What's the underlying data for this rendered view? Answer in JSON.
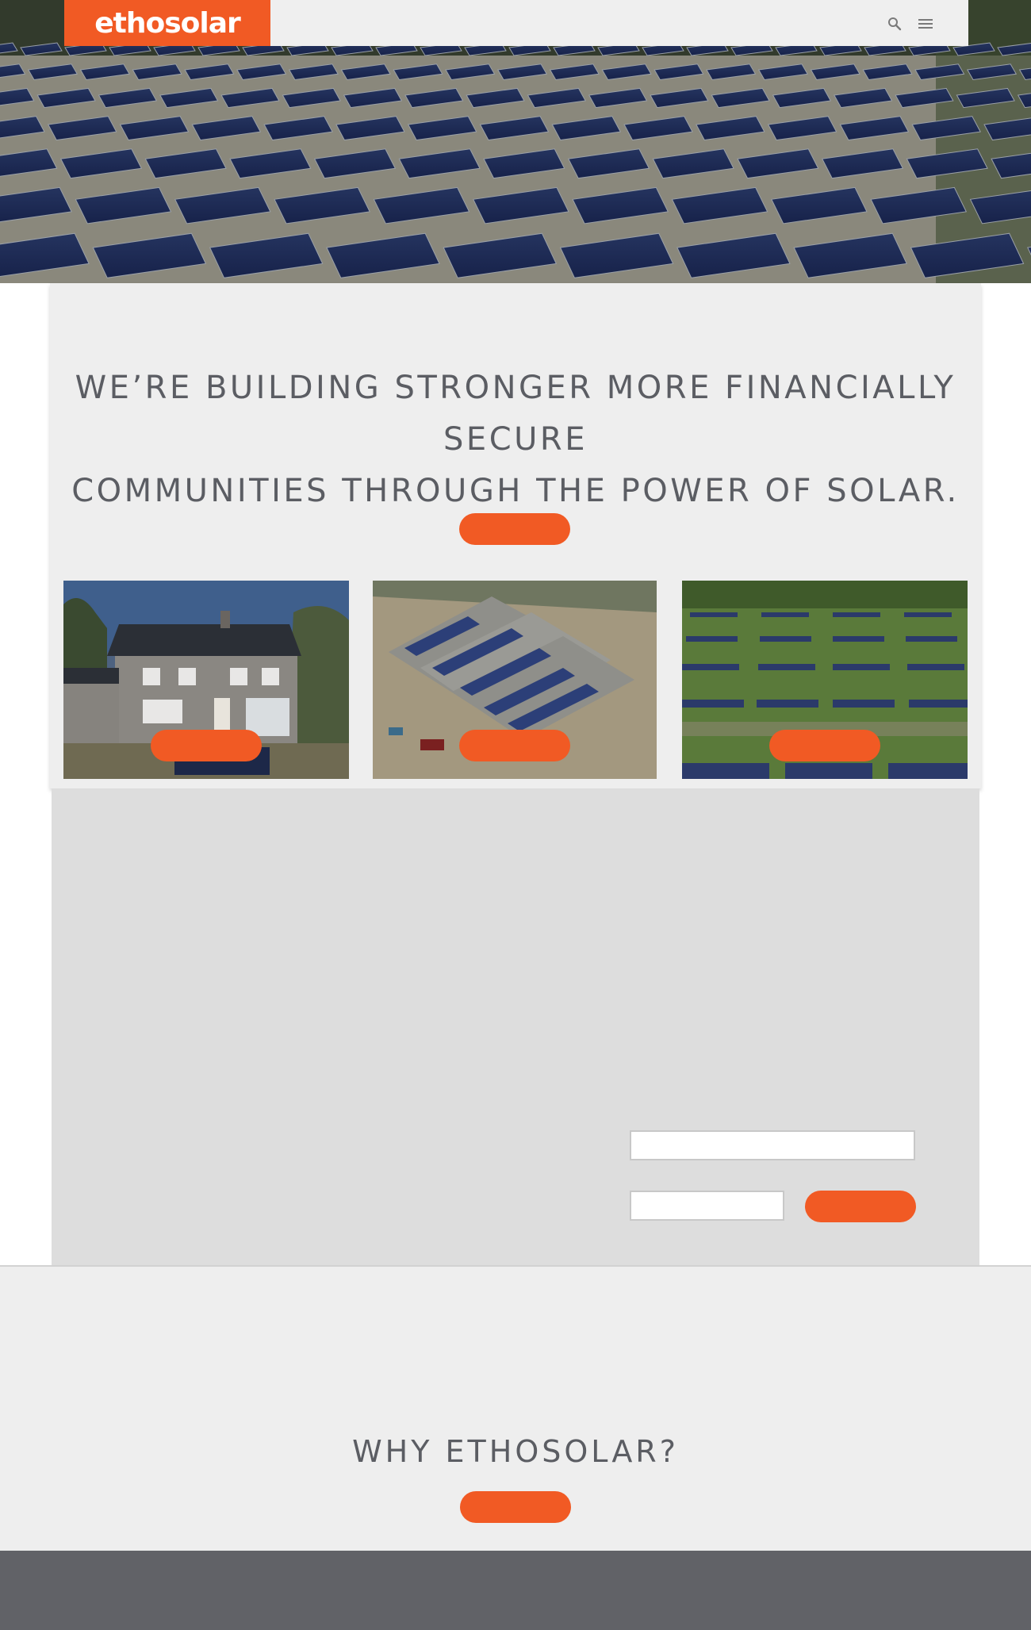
{
  "header": {
    "logo_text": "ethosolar",
    "search_icon": "search-icon",
    "menu_icon": "hamburger-menu-icon"
  },
  "hero": {
    "image": "solar-field-photo"
  },
  "mission": {
    "headline_line1": "WE’RE BUILDING STRONGER MORE FINANCIALLY SECURE",
    "headline_line2": "COMMUNITIES THROUGH THE POWER OF SOLAR.",
    "cta_label": "",
    "cards": [
      {
        "image": "residential-house-solar-photo",
        "button_label": ""
      },
      {
        "image": "commercial-rooftop-solar-photo",
        "button_label": ""
      },
      {
        "image": "solar-farm-photo",
        "button_label": ""
      }
    ]
  },
  "form": {
    "field1_placeholder": "",
    "field2_placeholder": "",
    "submit_label": ""
  },
  "why": {
    "title": "WHY ETHOSOLAR?",
    "cta_label": ""
  },
  "colors": {
    "accent": "#f15a24",
    "text_gray": "#5b5d63",
    "panel_bg": "#eeeeee",
    "form_bg": "#dddddd",
    "footer_bg": "#616267"
  }
}
